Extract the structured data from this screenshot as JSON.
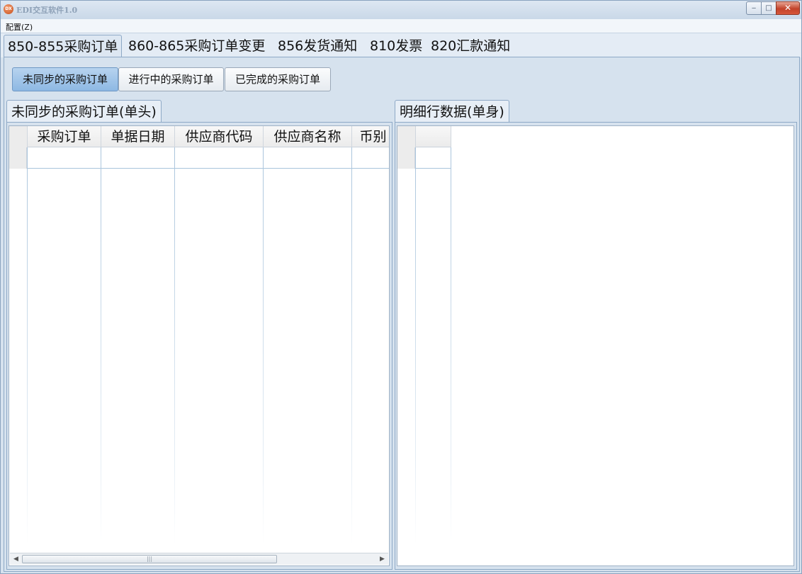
{
  "window": {
    "title": "EDI交互软件1.0",
    "icon_text": "DX",
    "controls": {
      "minimize": "‒",
      "maximize": "□",
      "close": "✕"
    }
  },
  "menu": {
    "items": [
      "配置(Z)"
    ]
  },
  "top_tabs": [
    {
      "label": "850-855采购订单",
      "active": true
    },
    {
      "label": "860-865采购订单变更",
      "active": false
    },
    {
      "label": "856发货通知",
      "active": false
    },
    {
      "label": "810发票",
      "active": false
    },
    {
      "label": "820汇款通知",
      "active": false
    }
  ],
  "sub_buttons": [
    {
      "label": "未同步的采购订单",
      "active": true
    },
    {
      "label": "进行中的采购订单",
      "active": false
    },
    {
      "label": "已完成的采购订单",
      "active": false
    }
  ],
  "header_panel": {
    "tab_label": "未同步的采购订单(单头)",
    "columns": [
      "采购订单",
      "单据日期",
      "供应商代码",
      "供应商名称",
      "币别"
    ]
  },
  "detail_panel": {
    "tab_label": "明细行数据(单身)",
    "columns": [
      ""
    ]
  },
  "scrollbar": {
    "left_arrow": "◀",
    "right_arrow": "▶",
    "grip": "|||"
  }
}
